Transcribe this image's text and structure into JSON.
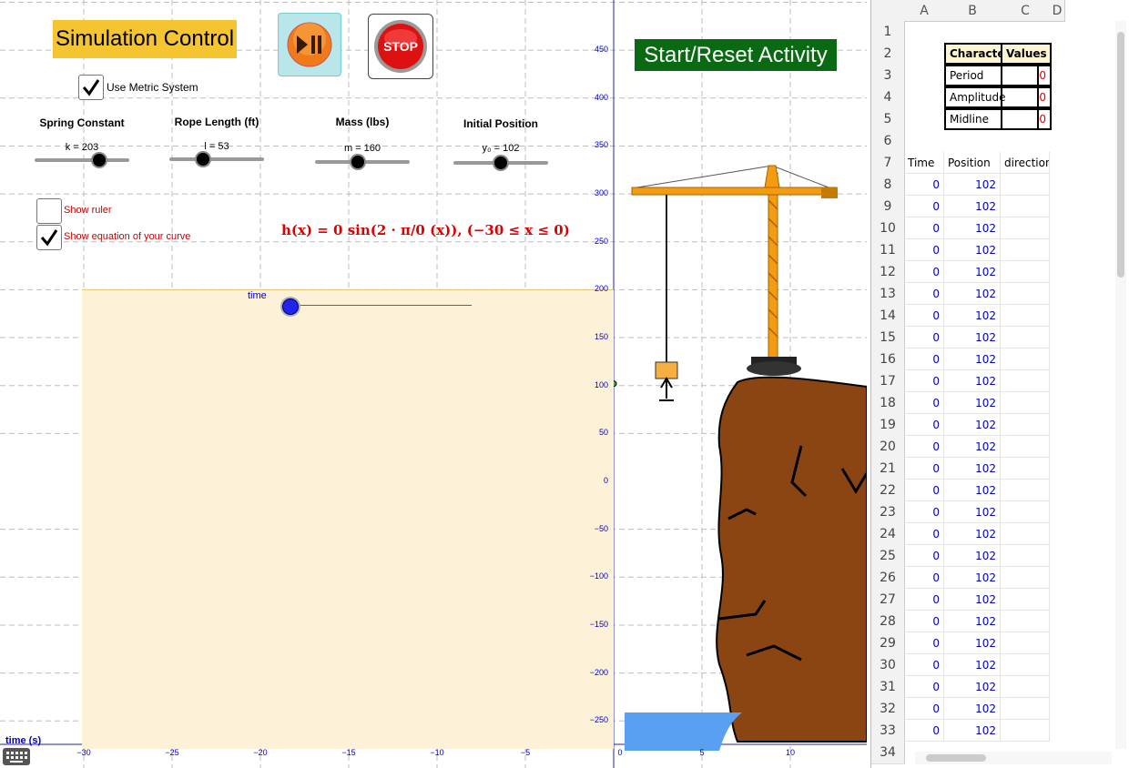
{
  "title": "Simulation Control",
  "buttons": {
    "play_pause": "play-pause",
    "stop_text": "STOP",
    "reset_text": "Start/Reset Activity"
  },
  "checkboxes": {
    "metric": {
      "label": "Use Metric System",
      "checked": true
    },
    "ruler": {
      "label": "Show  ruler",
      "checked": false
    },
    "equation": {
      "label": "Show equation of your curve",
      "checked": true
    }
  },
  "sliders": [
    {
      "title": "Spring Constant",
      "value_label": "k = 203",
      "fraction": 0.68
    },
    {
      "title": "Rope Length (ft)",
      "value_label": "l = 53",
      "fraction": 0.36
    },
    {
      "title": "Mass (lbs)",
      "value_label": "m = 160",
      "fraction": 0.45
    },
    {
      "title": "Initial Position",
      "value_label": "y₀ = 102",
      "fraction": 0.5
    }
  ],
  "equation": "h(x) = 0 sin(2 · π/0 (x)),   (−30 ≤ x ≤ 0)",
  "time_slider": {
    "label": "time",
    "fraction": 0.0
  },
  "axes": {
    "x_title": "time (s)",
    "x_ticks": [
      "−30",
      "−25",
      "−20",
      "−15",
      "−10",
      "−5",
      "0",
      "5",
      "10"
    ],
    "y_ticks": [
      "450",
      "400",
      "350",
      "300",
      "250",
      "200",
      "150",
      "100",
      "50",
      "0",
      "−50",
      "−100",
      "−150",
      "−200",
      "−250"
    ]
  },
  "colors": {
    "title_bg": "#f5c431",
    "reset_bg": "#0a6a14",
    "equation": "#dd0000",
    "axis": "#0000cc",
    "shade": "#fdf2d8",
    "cliff": "#8b4513",
    "crane": "#f39c12",
    "water": "#5aa0f0"
  },
  "icons": {
    "keyboard": "keyboard-icon",
    "crane": "crane-image",
    "cliff": "cliff-image",
    "checkmark": "checkmark-icon"
  },
  "sheet": {
    "columns": [
      "A",
      "B",
      "C",
      "D"
    ],
    "characteristics": {
      "header": "Characteristics",
      "values_header": "Values",
      "rows": [
        {
          "name": "Period",
          "value": "0"
        },
        {
          "name": "Amplitude",
          "value": "0"
        },
        {
          "name": "Midline",
          "value": "0"
        }
      ]
    },
    "data_headers": [
      "Time",
      "Position",
      "direction"
    ],
    "row_numbers": [
      "1",
      "2",
      "3",
      "4",
      "5",
      "6",
      "7",
      "8",
      "9",
      "10",
      "11",
      "12",
      "13",
      "14",
      "15",
      "16",
      "17",
      "18",
      "19",
      "20",
      "21",
      "22",
      "23",
      "24",
      "25",
      "26",
      "27",
      "28",
      "29",
      "30",
      "31",
      "32",
      "33",
      "34"
    ],
    "data_rows": [
      [
        "0",
        "102"
      ],
      [
        "0",
        "102"
      ],
      [
        "0",
        "102"
      ],
      [
        "0",
        "102"
      ],
      [
        "0",
        "102"
      ],
      [
        "0",
        "102"
      ],
      [
        "0",
        "102"
      ],
      [
        "0",
        "102"
      ],
      [
        "0",
        "102"
      ],
      [
        "0",
        "102"
      ],
      [
        "0",
        "102"
      ],
      [
        "0",
        "102"
      ],
      [
        "0",
        "102"
      ],
      [
        "0",
        "102"
      ],
      [
        "0",
        "102"
      ],
      [
        "0",
        "102"
      ],
      [
        "0",
        "102"
      ],
      [
        "0",
        "102"
      ],
      [
        "0",
        "102"
      ],
      [
        "0",
        "102"
      ],
      [
        "0",
        "102"
      ],
      [
        "0",
        "102"
      ],
      [
        "0",
        "102"
      ],
      [
        "0",
        "102"
      ],
      [
        "0",
        "102"
      ],
      [
        "0",
        "102"
      ]
    ]
  }
}
